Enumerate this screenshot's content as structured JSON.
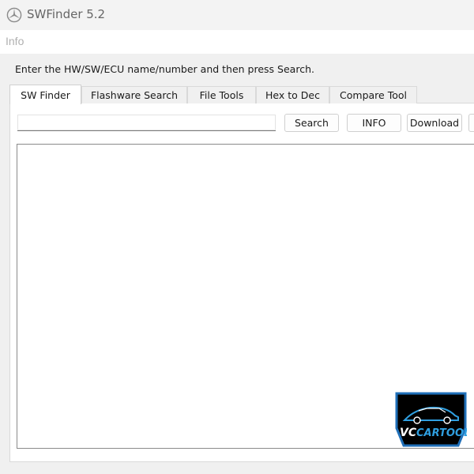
{
  "window": {
    "title": "SWFinder 5.2"
  },
  "menu": {
    "items": [
      "Info"
    ]
  },
  "instruction": "Enter the HW/SW/ECU name/number and then press Search.",
  "tabs": [
    {
      "label": "SW Finder",
      "active": true
    },
    {
      "label": "Flashware Search",
      "active": false
    },
    {
      "label": "File Tools",
      "active": false
    },
    {
      "label": "Hex to Dec",
      "active": false
    },
    {
      "label": "Compare Tool",
      "active": false
    }
  ],
  "search": {
    "value": "",
    "placeholder": ""
  },
  "buttons": {
    "search": "Search",
    "info": "INFO",
    "download": "Download"
  },
  "watermark": {
    "text_vc": "VC",
    "text_cartool": "CARTOOL",
    "colors": {
      "accent": "#2f9fe0",
      "frame": "#1f6fb8",
      "dark": "#000000"
    }
  },
  "icons": {
    "app": "mercedes-star-icon"
  }
}
